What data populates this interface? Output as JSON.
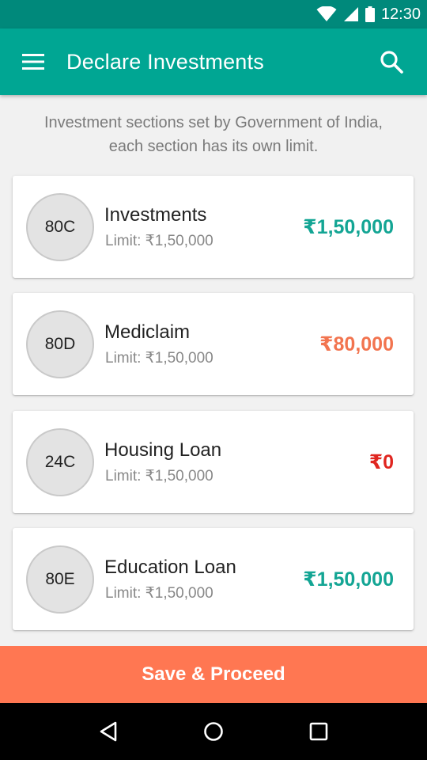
{
  "status_bar": {
    "time": "12:30",
    "icons": [
      "wifi-icon",
      "signal-icon",
      "battery-icon"
    ]
  },
  "app_bar": {
    "title": "Declare Investments",
    "menu_icon": "menu-icon",
    "search_icon": "search-icon"
  },
  "intro": "Investment sections set by Government of India, each section has its own limit.",
  "sections": [
    {
      "code": "80C",
      "title": "Investments",
      "limit": "Limit: ₹1,50,000",
      "amount": "₹1,50,000",
      "amount_color": "#13a594"
    },
    {
      "code": "80D",
      "title": "Mediclaim",
      "limit": "Limit: ₹1,50,000",
      "amount": "₹80,000",
      "amount_color": "#f2744f"
    },
    {
      "code": "24C",
      "title": "Housing Loan",
      "limit": "Limit: ₹1,50,000",
      "amount": "₹0",
      "amount_color": "#e02620"
    },
    {
      "code": "80E",
      "title": "Education Loan",
      "limit": "Limit: ₹1,50,000",
      "amount": "₹1,50,000",
      "amount_color": "#13a594"
    }
  ],
  "save_button": "Save & Proceed",
  "colors": {
    "primary": "#00a693",
    "status_bar": "#00897b",
    "accent": "#ff7752"
  },
  "nav_bar": {
    "icons": [
      "back-icon",
      "home-icon",
      "recents-icon"
    ]
  }
}
